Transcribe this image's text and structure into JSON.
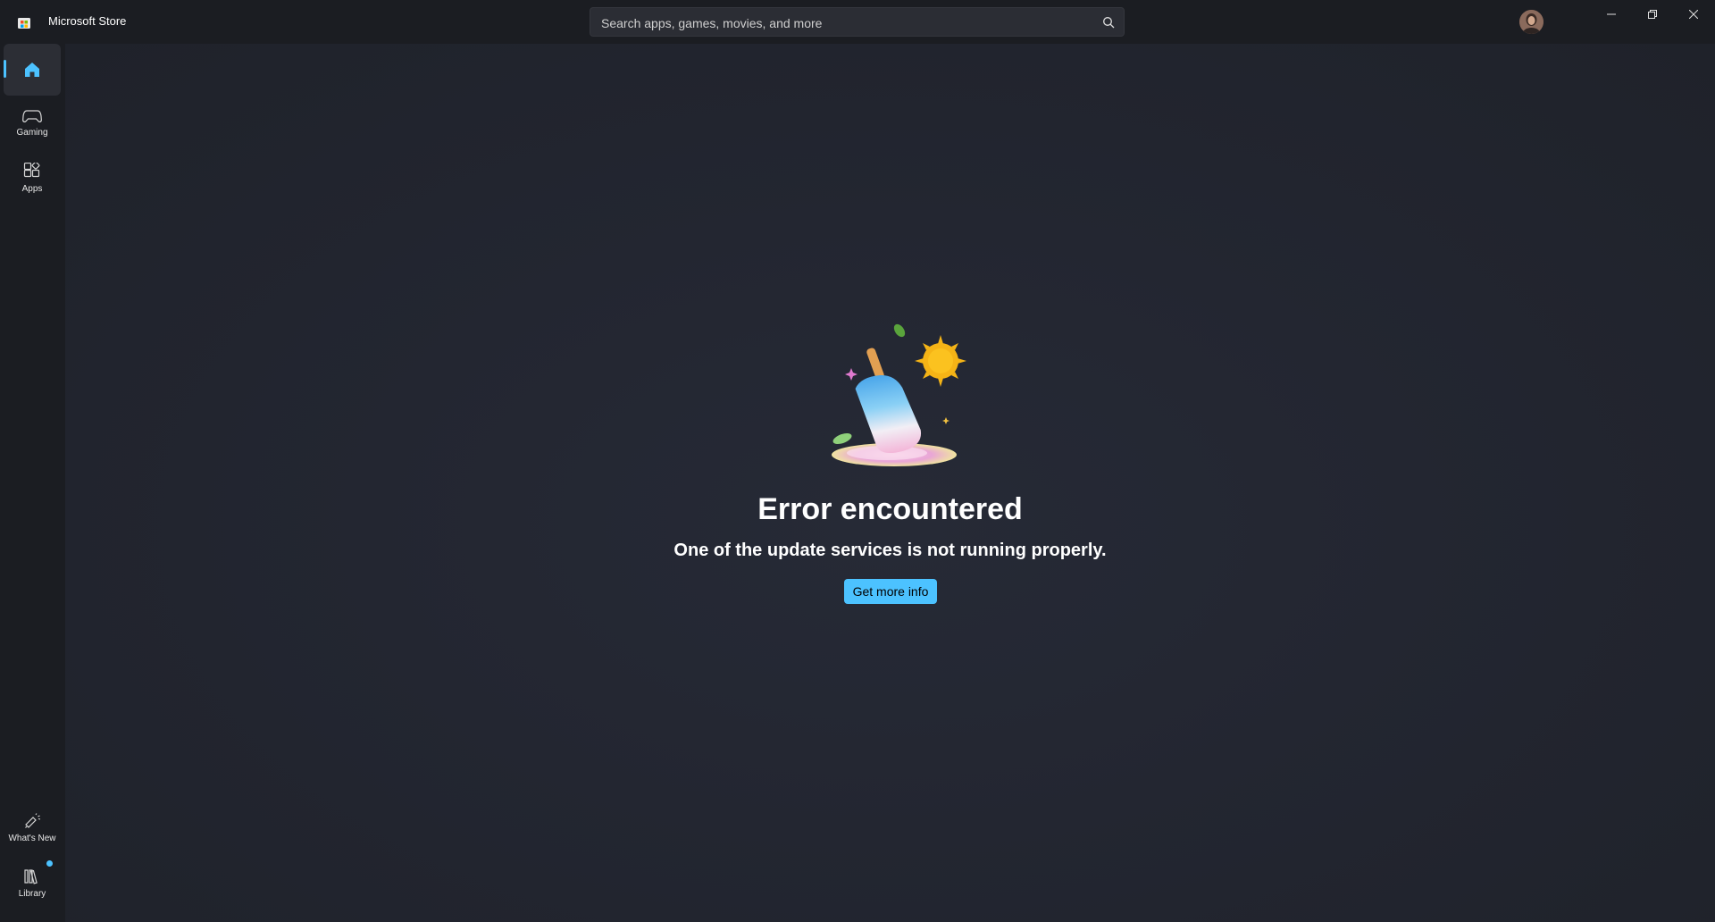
{
  "app": {
    "title": "Microsoft Store"
  },
  "search": {
    "placeholder": "Search apps, games, movies, and more",
    "icon": "search-icon"
  },
  "window_controls": {
    "minimize_icon": "minimize-icon",
    "restore_icon": "restore-icon",
    "close_icon": "close-icon"
  },
  "sidebar": {
    "top_items": [
      {
        "label": "",
        "icon": "home-icon",
        "active": true
      },
      {
        "label": "Gaming",
        "icon": "gamepad-icon",
        "active": false
      },
      {
        "label": "Apps",
        "icon": "apps-icon",
        "active": false
      }
    ],
    "bottom_items": [
      {
        "label": "What's New",
        "icon": "megaphone-icon"
      },
      {
        "label": "Library",
        "icon": "library-icon",
        "has_badge": true
      }
    ]
  },
  "main": {
    "error_title": "Error encountered",
    "error_message": "One of the update services is not running properly.",
    "button_label": "Get more info"
  },
  "colors": {
    "accent": "#4cc2ff",
    "background": "#1c1e24",
    "content_background": "#232631"
  }
}
